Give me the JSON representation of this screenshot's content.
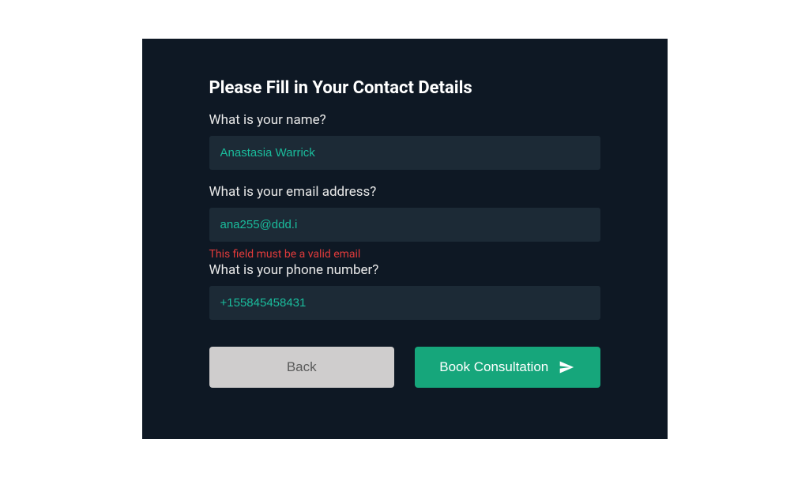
{
  "form": {
    "title": "Please Fill in Your Contact Details",
    "fields": {
      "name": {
        "label": "What is your name?",
        "value": "Anastasia Warrick"
      },
      "email": {
        "label": "What is your email address?",
        "value": "ana255@ddd.i",
        "error": "This field must be a valid email"
      },
      "phone": {
        "label": "What is your phone number?",
        "value": "+155845458431"
      }
    },
    "buttons": {
      "back": "Back",
      "submit": "Book Consultation"
    }
  }
}
